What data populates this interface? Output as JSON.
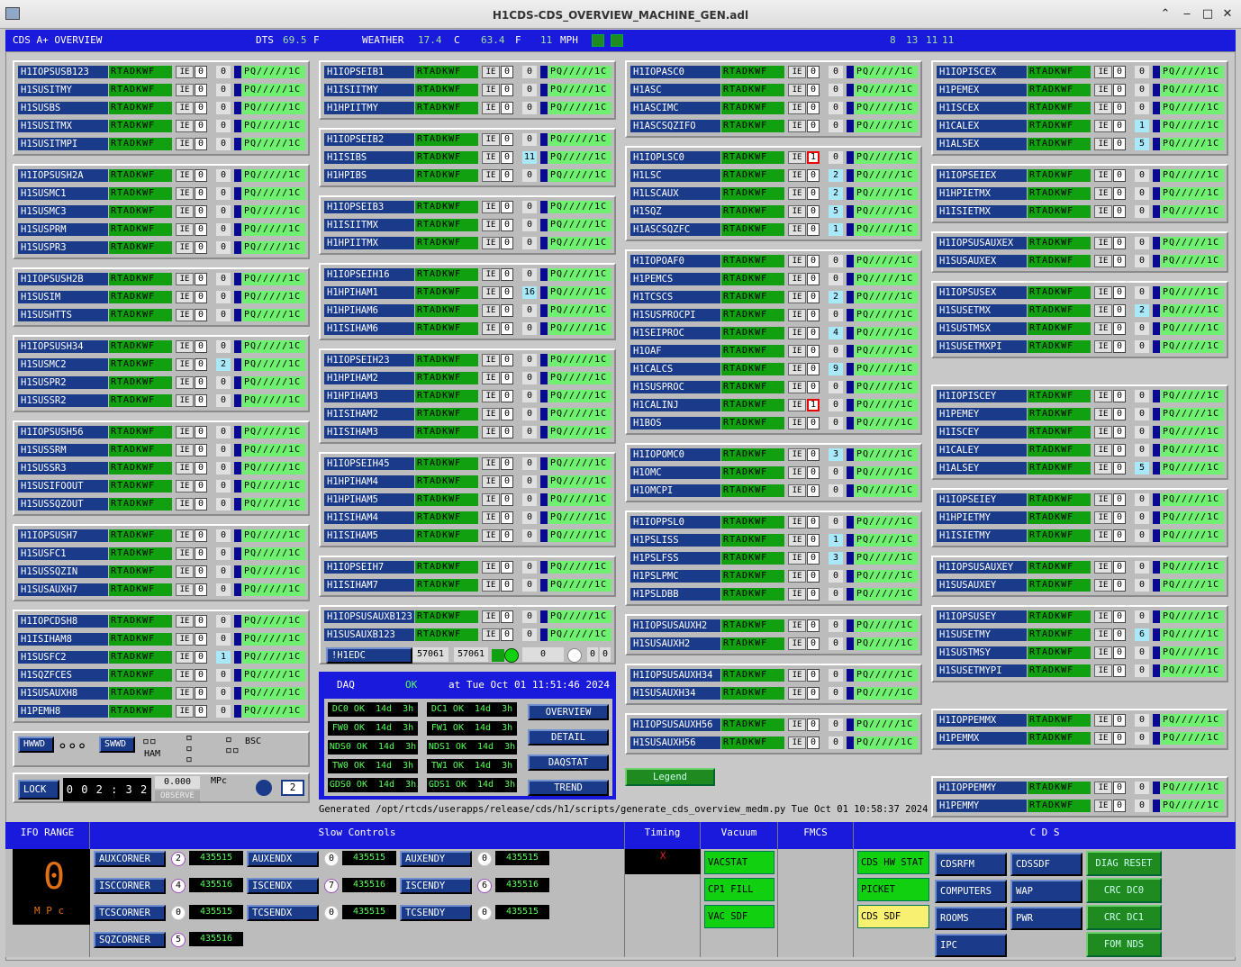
{
  "window": {
    "title": "H1CDS-CDS_OVERVIEW_MACHINE_GEN.adl"
  },
  "header": {
    "label": "CDS A+ OVERVIEW",
    "dts_label": "DTS",
    "dts_val": "69.5",
    "dts_unit": "F",
    "weather_label": "WEATHER",
    "w1": "17.4",
    "w1u": "C",
    "w2": "63.4",
    "w2u": "F",
    "w3": "11",
    "w3u": "MPH",
    "n1": "8",
    "n2": "13",
    "n3": "11"
  },
  "status": {
    "rtadkwf": "RTADKWF",
    "ie": "IE",
    "pq": "PQ/////1C",
    "zero": "0"
  },
  "systems": [
    {
      "id": "g1",
      "rows": [
        [
          "H1IOPSUSB123",
          "0",
          "0"
        ],
        [
          "H1SUSITMY",
          "0",
          "0"
        ],
        [
          "H1SUSBS",
          "0",
          "0"
        ],
        [
          "H1SUSITMX",
          "0",
          "0"
        ],
        [
          "H1SUSITMPI",
          "0",
          "0"
        ]
      ]
    },
    {
      "id": "g2",
      "rows": [
        [
          "H1IOPSUSH2A",
          "0",
          "0"
        ],
        [
          "H1SUSMC1",
          "0",
          "0"
        ],
        [
          "H1SUSMC3",
          "0",
          "0"
        ],
        [
          "H1SUSPRM",
          "0",
          "0"
        ],
        [
          "H1SUSPR3",
          "0",
          "0"
        ]
      ]
    },
    {
      "id": "g3",
      "rows": [
        [
          "H1IOPSUSH2B",
          "0",
          "0"
        ],
        [
          "H1SUSIM",
          "0",
          "0"
        ],
        [
          "H1SUSHTTS",
          "0",
          "0"
        ]
      ]
    },
    {
      "id": "g4",
      "rows": [
        [
          "H1IOPSUSH34",
          "0",
          "0"
        ],
        [
          "H1SUSMC2",
          "0",
          "2"
        ],
        [
          "H1SUSPR2",
          "0",
          "0"
        ],
        [
          "H1SUSSR2",
          "0",
          "0"
        ]
      ]
    },
    {
      "id": "g5",
      "rows": [
        [
          "H1IOPSUSH56",
          "0",
          "0"
        ],
        [
          "H1SUSSRM",
          "0",
          "0"
        ],
        [
          "H1SUSSR3",
          "0",
          "0"
        ],
        [
          "H1SUSIFOOUT",
          "0",
          "0"
        ],
        [
          "H1SUSSQZOUT",
          "0",
          "0"
        ]
      ]
    },
    {
      "id": "g6",
      "rows": [
        [
          "H1IOPSUSH7",
          "0",
          "0"
        ],
        [
          "H1SUSFC1",
          "0",
          "0"
        ],
        [
          "H1SUSSQZIN",
          "0",
          "0"
        ],
        [
          "H1SUSAUXH7",
          "0",
          "0"
        ]
      ]
    },
    {
      "id": "g7",
      "rows": [
        [
          "H1IOPCDSH8",
          "0",
          "0"
        ],
        [
          "H1ISIHAM8",
          "0",
          "0"
        ],
        [
          "H1SUSFC2",
          "0",
          "1"
        ],
        [
          "H1SQZFCES",
          "0",
          "0"
        ],
        [
          "H1SUSAUXH8",
          "0",
          "0"
        ],
        [
          "H1PEMH8",
          "0",
          "0"
        ]
      ]
    },
    {
      "id": "g8",
      "rows": [
        [
          "H1IOPSEIB1",
          "0",
          "0"
        ],
        [
          "H1ISIITMY",
          "0",
          "0"
        ],
        [
          "H1HPIITMY",
          "0",
          "0"
        ]
      ]
    },
    {
      "id": "g9",
      "rows": [
        [
          "H1IOPSEIB2",
          "0",
          "0"
        ],
        [
          "H1ISIBS",
          "0",
          "11"
        ],
        [
          "H1HPIBS",
          "0",
          "0"
        ]
      ]
    },
    {
      "id": "g10",
      "rows": [
        [
          "H1IOPSEIB3",
          "0",
          "0"
        ],
        [
          "H1ISIITMX",
          "0",
          "0"
        ],
        [
          "H1HPIITMX",
          "0",
          "0"
        ]
      ]
    },
    {
      "id": "g11",
      "rows": [
        [
          "H1IOPSEIH16",
          "0",
          "0"
        ],
        [
          "H1HPIHAM1",
          "0",
          "16"
        ],
        [
          "H1HPIHAM6",
          "0",
          "0"
        ],
        [
          "H1ISIHAM6",
          "0",
          "0"
        ]
      ]
    },
    {
      "id": "g12",
      "rows": [
        [
          "H1IOPSEIH23",
          "0",
          "0"
        ],
        [
          "H1HPIHAM2",
          "0",
          "0"
        ],
        [
          "H1HPIHAM3",
          "0",
          "0"
        ],
        [
          "H1ISIHAM2",
          "0",
          "0"
        ],
        [
          "H1ISIHAM3",
          "0",
          "0"
        ]
      ]
    },
    {
      "id": "g13",
      "rows": [
        [
          "H1IOPSEIH45",
          "0",
          "0"
        ],
        [
          "H1HPIHAM4",
          "0",
          "0"
        ],
        [
          "H1HPIHAM5",
          "0",
          "0"
        ],
        [
          "H1ISIHAM4",
          "0",
          "0"
        ],
        [
          "H1ISIHAM5",
          "0",
          "0"
        ]
      ]
    },
    {
      "id": "g14",
      "rows": [
        [
          "H1IOPSEIH7",
          "0",
          "0"
        ],
        [
          "H1ISIHAM7",
          "0",
          "0"
        ]
      ]
    },
    {
      "id": "g15",
      "rows": [
        [
          "H1IOPSUSAUXB123",
          "0",
          "0"
        ],
        [
          "H1SUSAUXB123",
          "0",
          "0"
        ]
      ]
    },
    {
      "id": "g16",
      "rows": [
        [
          "H1IOPASC0",
          "0",
          "0"
        ],
        [
          "H1ASC",
          "0",
          "0"
        ],
        [
          "H1ASCIMC",
          "0",
          "0"
        ],
        [
          "H1ASCSQZIFO",
          "0",
          "0"
        ]
      ]
    },
    {
      "id": "g17",
      "rows": [
        [
          "H1IOPLSC0",
          "1",
          "0"
        ],
        [
          "H1LSC",
          "0",
          "2"
        ],
        [
          "H1LSCAUX",
          "0",
          "2"
        ],
        [
          "H1SQZ",
          "0",
          "5"
        ],
        [
          "H1ASCSQZFC",
          "0",
          "1"
        ]
      ]
    },
    {
      "id": "g18",
      "rows": [
        [
          "H1IOPOAF0",
          "0",
          "0"
        ],
        [
          "H1PEMCS",
          "0",
          "0"
        ],
        [
          "H1TCSCS",
          "0",
          "2"
        ],
        [
          "H1SUSPROCPI",
          "0",
          "0"
        ],
        [
          "H1SEIPROC",
          "0",
          "4"
        ],
        [
          "H1OAF",
          "0",
          "0"
        ],
        [
          "H1CALCS",
          "0",
          "9"
        ],
        [
          "H1SUSPROC",
          "0",
          "0"
        ],
        [
          "H1CALINJ",
          "1",
          "0"
        ],
        [
          "H1BOS",
          "0",
          "0"
        ]
      ]
    },
    {
      "id": "g19",
      "rows": [
        [
          "H1IOPOMC0",
          "0",
          "3"
        ],
        [
          "H1OMC",
          "0",
          "0"
        ],
        [
          "H1OMCPI",
          "0",
          "0"
        ]
      ]
    },
    {
      "id": "g20",
      "rows": [
        [
          "H1IOPPSL0",
          "0",
          "0"
        ],
        [
          "H1PSLISS",
          "0",
          "1"
        ],
        [
          "H1PSLFSS",
          "0",
          "3"
        ],
        [
          "H1PSLPMC",
          "0",
          "0"
        ],
        [
          "H1PSLDBB",
          "0",
          "0"
        ]
      ]
    },
    {
      "id": "g21",
      "rows": [
        [
          "H1IOPSUSAUXH2",
          "0",
          "0"
        ],
        [
          "H1SUSAUXH2",
          "0",
          "0"
        ]
      ]
    },
    {
      "id": "g22",
      "rows": [
        [
          "H1IOPSUSAUXH34",
          "0",
          "0"
        ],
        [
          "H1SUSAUXH34",
          "0",
          "0"
        ]
      ]
    },
    {
      "id": "g23",
      "rows": [
        [
          "H1IOPSUSAUXH56",
          "0",
          "0"
        ],
        [
          "H1SUSAUXH56",
          "0",
          "0"
        ]
      ]
    },
    {
      "id": "g24",
      "rows": [
        [
          "H1IOPISCEX",
          "0",
          "0"
        ],
        [
          "H1PEMEX",
          "0",
          "0"
        ],
        [
          "H1ISCEX",
          "0",
          "0"
        ],
        [
          "H1CALEX",
          "0",
          "1"
        ],
        [
          "H1ALSEX",
          "0",
          "5"
        ]
      ]
    },
    {
      "id": "g25",
      "rows": [
        [
          "H1IOPSEIEX",
          "0",
          "0"
        ],
        [
          "H1HPIETMX",
          "0",
          "0"
        ],
        [
          "H1ISIETMX",
          "0",
          "0"
        ]
      ]
    },
    {
      "id": "g26",
      "rows": [
        [
          "H1IOPSUSAUXEX",
          "0",
          "0"
        ],
        [
          "H1SUSAUXEX",
          "0",
          "0"
        ]
      ]
    },
    {
      "id": "g27",
      "rows": [
        [
          "H1IOPSUSEX",
          "0",
          "0"
        ],
        [
          "H1SUSETMX",
          "0",
          "2"
        ],
        [
          "H1SUSTMSX",
          "0",
          "0"
        ],
        [
          "H1SUSETMXPI",
          "0",
          "0"
        ]
      ]
    },
    {
      "id": "g28",
      "rows": [
        [
          "H1IOPISCEY",
          "0",
          "0"
        ],
        [
          "H1PEMEY",
          "0",
          "0"
        ],
        [
          "H1ISCEY",
          "0",
          "0"
        ],
        [
          "H1CALEY",
          "0",
          "0"
        ],
        [
          "H1ALSEY",
          "0",
          "5"
        ]
      ]
    },
    {
      "id": "g29",
      "rows": [
        [
          "H1IOPSEIEY",
          "0",
          "0"
        ],
        [
          "H1HPIETMY",
          "0",
          "0"
        ],
        [
          "H1ISIETMY",
          "0",
          "0"
        ]
      ]
    },
    {
      "id": "g30",
      "rows": [
        [
          "H1IOPSUSAUXEY",
          "0",
          "0"
        ],
        [
          "H1SUSAUXEY",
          "0",
          "0"
        ]
      ]
    },
    {
      "id": "g31",
      "rows": [
        [
          "H1IOPSUSEY",
          "0",
          "0"
        ],
        [
          "H1SUSETMY",
          "0",
          "6"
        ],
        [
          "H1SUSTMSY",
          "0",
          "0"
        ],
        [
          "H1SUSETMYPI",
          "0",
          "0"
        ]
      ]
    },
    {
      "id": "g32",
      "rows": [
        [
          "H1IOPPEMMX",
          "0",
          "0"
        ],
        [
          "H1PEMMX",
          "0",
          "0"
        ]
      ]
    },
    {
      "id": "g33",
      "rows": [
        [
          "H1IOPPEMMY",
          "0",
          "0"
        ],
        [
          "H1PEMMY",
          "0",
          "0"
        ]
      ]
    }
  ],
  "edc": {
    "label": "!H1EDC",
    "v1": "57061",
    "v2": "57061",
    "v3": "0",
    "v4": "0",
    "v5": "0"
  },
  "hw": {
    "hwwd": "HWWD",
    "swwd": "SWWD",
    "ham": "HAM",
    "bsc": "BSC"
  },
  "lock": {
    "label": "LOCK",
    "time": "0 0 2 : 3 2",
    "mpc_val": "0.000",
    "mpc_unit": "MPc",
    "observe": "OBSERVE",
    "num": "2"
  },
  "daq": {
    "label": "DAQ",
    "status": "OK",
    "at": "at",
    "time": "Tue Oct 01 11:51:46 2024",
    "rows": [
      [
        "DC0 OK  14d  3h",
        "DC1 OK  14d  3h"
      ],
      [
        "FW0 OK  14d  3h",
        "FW1 OK  14d  3h"
      ],
      [
        "NDS0 OK  14d  3h",
        "NDS1 OK  14d  3h"
      ],
      [
        "TW0 OK  14d  3h",
        "TW1 OK  14d  3h"
      ],
      [
        "GDS0 OK  14d  3h",
        "GDS1 OK  14d  3h"
      ]
    ],
    "buttons": [
      "OVERVIEW",
      "DETAIL",
      "DAQSTAT",
      "TREND"
    ]
  },
  "legend": "Legend",
  "generated": "Generated /opt/rtcds/userapps/release/cds/h1/scripts/generate_cds_overview_medm.py Tue Oct 01 10:58:37 2024",
  "bottom": {
    "ifo_range": "IFO RANGE",
    "range_val": "0",
    "range_unit": "M P c",
    "slow": "Slow Controls",
    "corners": [
      [
        "AUXCORNER",
        "2",
        "435515"
      ],
      [
        "ISCCORNER",
        "4",
        "435516"
      ],
      [
        "TCSCORNER",
        "0",
        "435515"
      ],
      [
        "SQZCORNER",
        "5",
        "435516"
      ]
    ],
    "ends_x": [
      [
        "AUXENDX",
        "0",
        "435515"
      ],
      [
        "ISCENDX",
        "7",
        "435516"
      ],
      [
        "TCSENDX",
        "0",
        "435515"
      ]
    ],
    "ends_y": [
      [
        "AUXENDY",
        "0",
        "435515"
      ],
      [
        "ISCENDY",
        "6",
        "435516"
      ],
      [
        "TCSENDY",
        "0",
        "435515"
      ]
    ],
    "timing": "Timing",
    "timing_x": "X",
    "vacuum": "Vacuum",
    "vac_btns": [
      "VACSTAT",
      "CP1 FILL",
      "VAC SDF"
    ],
    "fmcs": "FMCS",
    "cds": "C D S",
    "cds_btns": [
      "CDS HW STAT",
      "PICKET FENCE",
      "CDS SDF"
    ],
    "cds_nav1": [
      "CDSRFM",
      "COMPUTERS",
      "ROOMS",
      "IPC"
    ],
    "cds_nav2": [
      "CDSSDF",
      "WAP",
      "PWR"
    ],
    "cds_actions": [
      "DIAG RESET",
      "CRC DC0",
      "CRC DC1",
      "FOM NDS"
    ]
  }
}
